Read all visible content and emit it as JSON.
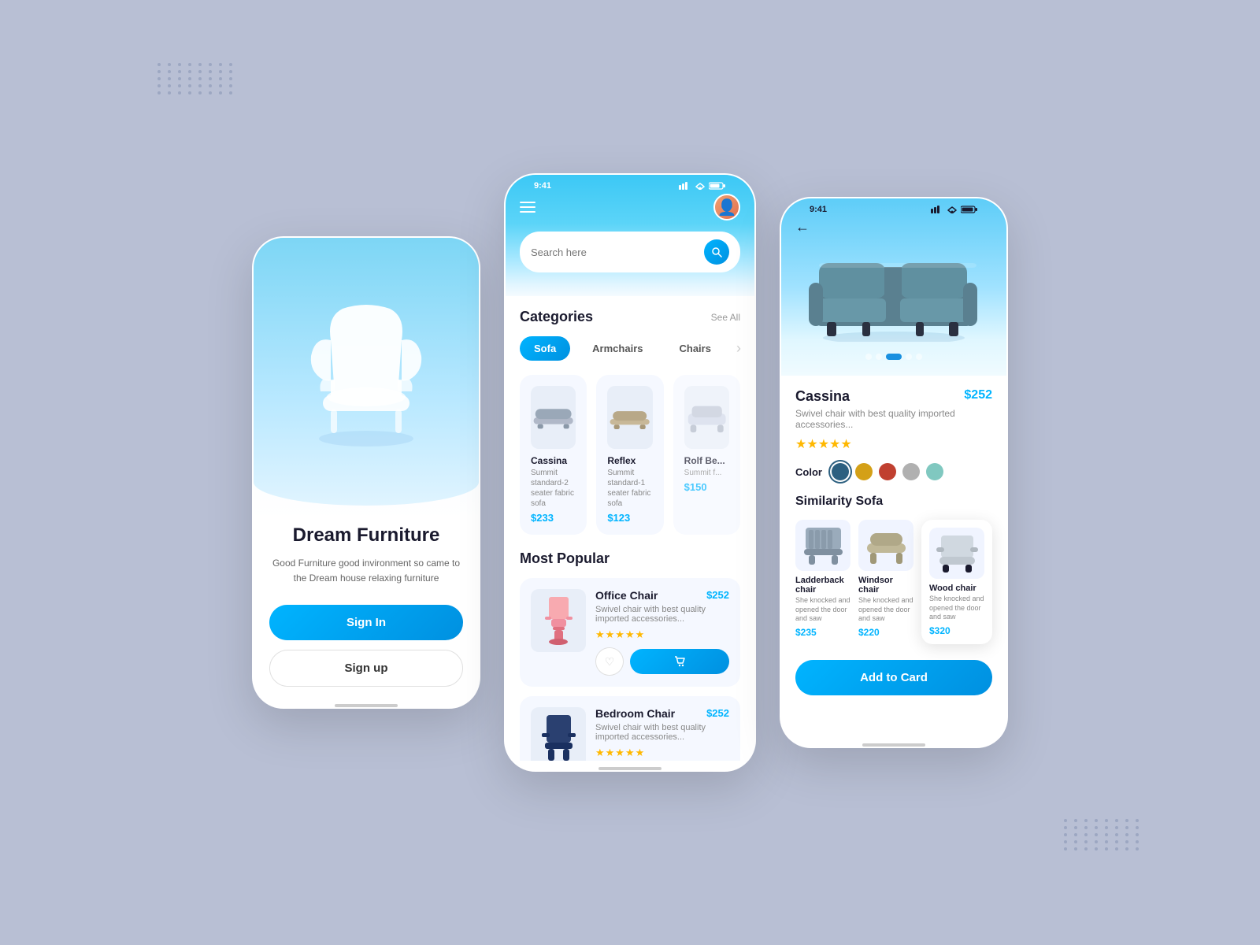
{
  "background": "#b8bfd4",
  "phone1": {
    "title": "Dream Furniture",
    "subtitle": "Good Furniture good invironment so came to the Dream house relaxing furniture",
    "signin_label": "Sign In",
    "signup_label": "Sign up"
  },
  "phone2": {
    "status_time": "9:41",
    "search_placeholder": "Search here",
    "categories_title": "Categories",
    "see_all": "See All",
    "categories": [
      "Sofa",
      "Armchairs",
      "Chairs"
    ],
    "active_category": "Sofa",
    "products": [
      {
        "name": "Cassina",
        "desc": "Summit standard-2 seater fabric sofa",
        "price": "$233"
      },
      {
        "name": "Reflex",
        "desc": "Summit standard-1 seater fabric sofa",
        "price": "$123"
      },
      {
        "name": "Rolf Be...",
        "desc": "Summit f...",
        "price": "$150"
      }
    ],
    "most_popular_title": "Most Popular",
    "popular_items": [
      {
        "name": "Office Chair",
        "price": "$252",
        "desc": "Swivel chair with best quality imported accessories...",
        "stars": 5
      },
      {
        "name": "Bedroom Chair",
        "price": "$252",
        "desc": "Swivel chair with best quality imported accessories...",
        "stars": 5
      }
    ]
  },
  "phone3": {
    "status_time": "9:41",
    "product_name": "Cassina",
    "product_price": "$252",
    "product_desc": "Swivel chair with best quality imported accessories...",
    "stars": 5,
    "color_label": "Color",
    "colors": [
      "#2d6080",
      "#d4a017",
      "#c04030",
      "#b0b0b0",
      "#80c8c0"
    ],
    "active_color": "#2d6080",
    "similarity_title": "Similarity Sofa",
    "similar_products": [
      {
        "name": "Ladderback chair",
        "desc": "She knocked and opened the door and saw",
        "price": "$235"
      },
      {
        "name": "Windsor chair",
        "desc": "She knocked and opened the door and saw",
        "price": "$220"
      },
      {
        "name": "Wood chair",
        "desc": "She knocked and opened the door and saw",
        "price": "$320"
      }
    ],
    "add_to_cart": "Add to Card",
    "carousel_dots": 5,
    "active_dot": 3
  }
}
